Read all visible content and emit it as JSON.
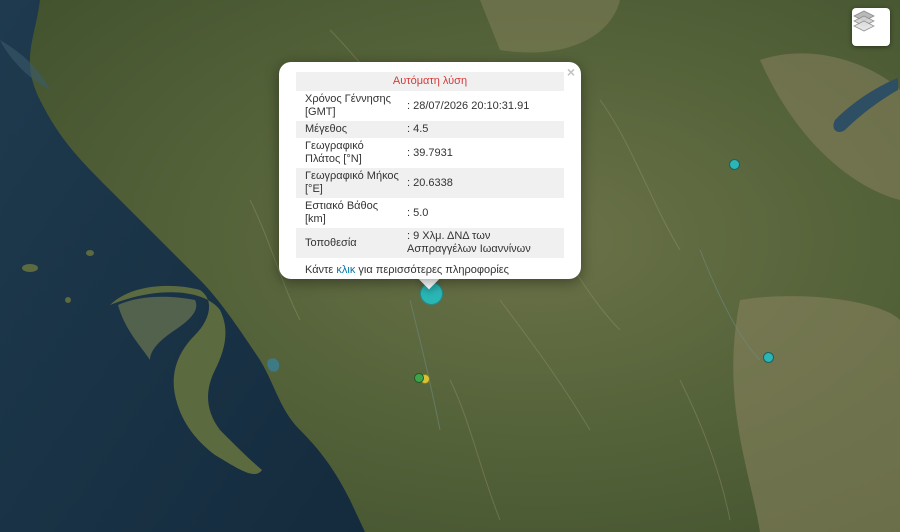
{
  "map": {
    "markers": [
      {
        "name": "earthquake-marker-main",
        "color": "#2bb6b6"
      },
      {
        "name": "earthquake-marker-ne",
        "color": "#2bb6b6"
      },
      {
        "name": "earthquake-marker-e",
        "color": "#2bb6b6"
      },
      {
        "name": "earthquake-marker-green",
        "color": "#3fa34d"
      },
      {
        "name": "earthquake-marker-yellow",
        "color": "#d7c33a"
      }
    ],
    "layers_icon": "layers-icon"
  },
  "popup": {
    "title": "Αυτόματη λύση",
    "close_label": "×",
    "rows": [
      {
        "label": "Χρόνος Γέννησης [GMT]",
        "value": ": 28/07/2026 20:10:31.91"
      },
      {
        "label": "Μέγεθος",
        "value": ": 4.5"
      },
      {
        "label": "Γεωγραφικό Πλάτος [°N]",
        "value": ": 39.7931"
      },
      {
        "label": "Γεωγραφικό Μήκος [°E]",
        "value": ": 20.6338"
      },
      {
        "label": "Εστιακό Βάθος [km]",
        "value": ": 5.0"
      },
      {
        "label": "Τοποθεσία",
        "value": ": 9 Χλμ. ΔΝΔ των Ασπραγγέλων Ιωαννίνων"
      }
    ],
    "more_prefix": "Κάντε ",
    "more_link": "κλικ",
    "more_suffix": " για περισσότερες πληροφορίες"
  }
}
